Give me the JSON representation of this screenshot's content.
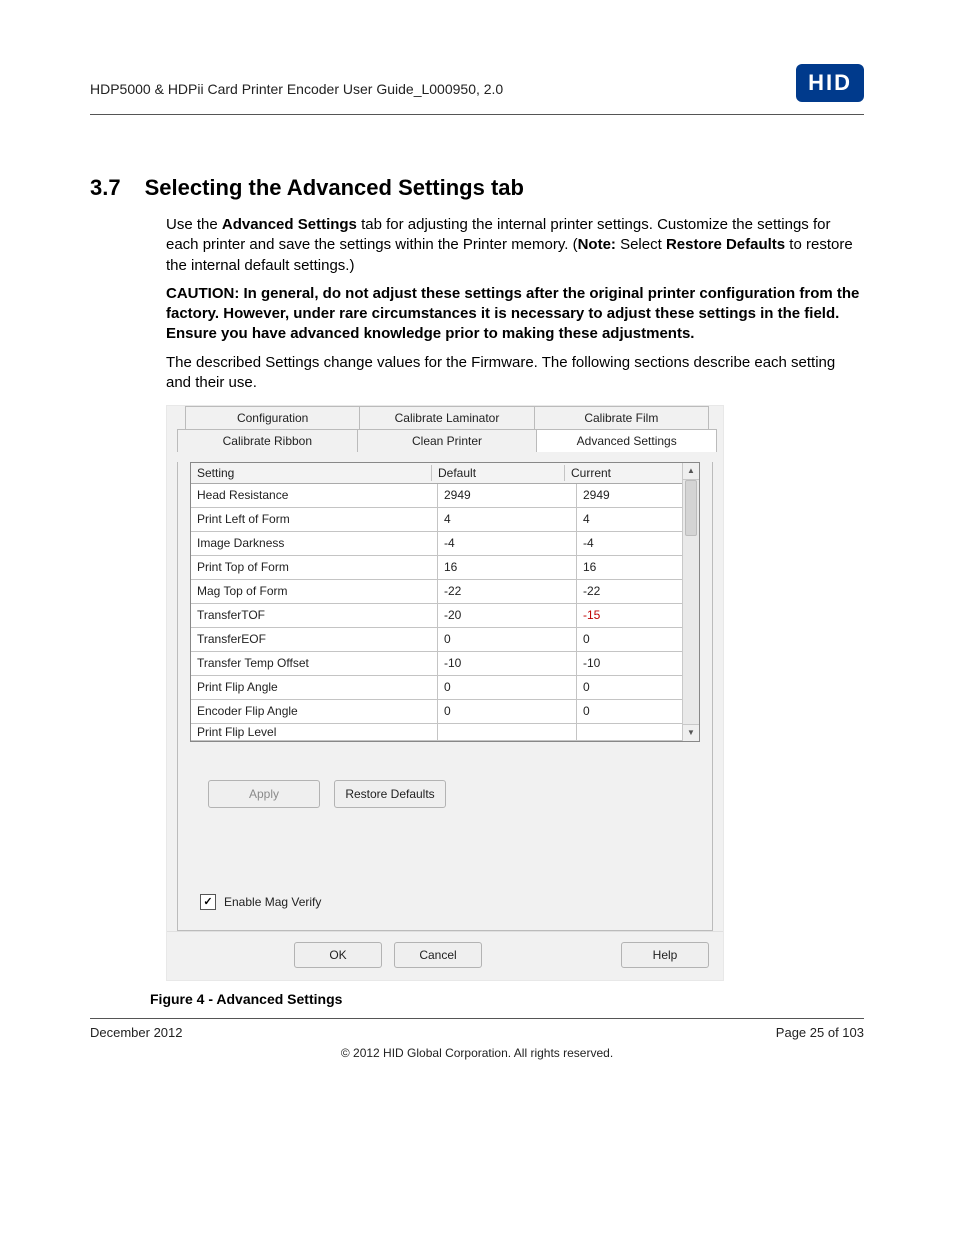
{
  "header": {
    "doc_title": "HDP5000 & HDPii Card Printer Encoder User Guide_L000950, 2.0",
    "logo_text": "HID"
  },
  "section": {
    "number": "3.7",
    "title": "Selecting the Advanced Settings tab",
    "p1a": "Use the ",
    "p1b": "Advanced Settings",
    "p1c": " tab for adjusting the internal printer settings. Customize the settings for each printer and save the settings within the Printer memory. (",
    "p1d": "Note:",
    "p1e": "  Select ",
    "p1f": "Restore Defaults",
    "p1g": " to restore the internal default settings.)",
    "caution": "CAUTION: In general, do not adjust these settings after the original printer configuration from the factory.  However, under rare circumstances it is necessary to adjust these settings in the field.  Ensure you have advanced knowledge prior to making these adjustments.",
    "p3": "The described Settings change values for the Firmware. The following sections describe each setting and their use."
  },
  "dialog": {
    "tabs_row1": [
      "Configuration",
      "Calibrate Laminator",
      "Calibrate Film"
    ],
    "tabs_row2": [
      "Calibrate Ribbon",
      "Clean Printer",
      "Advanced Settings"
    ],
    "headers": {
      "setting": "Setting",
      "default": "Default",
      "current": "Current"
    },
    "rows": [
      {
        "s": "Head Resistance",
        "d": "2949",
        "c": "2949",
        "diff": false
      },
      {
        "s": "Print Left of Form",
        "d": "4",
        "c": "4",
        "diff": false
      },
      {
        "s": "Image Darkness",
        "d": "-4",
        "c": "-4",
        "diff": false
      },
      {
        "s": "Print Top of Form",
        "d": "16",
        "c": "16",
        "diff": false
      },
      {
        "s": "Mag Top of Form",
        "d": "-22",
        "c": "-22",
        "diff": false
      },
      {
        "s": "TransferTOF",
        "d": "-20",
        "c": "-15",
        "diff": true
      },
      {
        "s": "TransferEOF",
        "d": "0",
        "c": "0",
        "diff": false
      },
      {
        "s": "Transfer Temp Offset",
        "d": "-10",
        "c": "-10",
        "diff": false
      },
      {
        "s": "Print Flip Angle",
        "d": "0",
        "c": "0",
        "diff": false
      },
      {
        "s": "Encoder Flip Angle",
        "d": "0",
        "c": "0",
        "diff": false
      }
    ],
    "partial_row_label": "Print Flip Level",
    "apply": "Apply",
    "restore": "Restore Defaults",
    "mag_label": "Enable Mag Verify",
    "ok": "OK",
    "cancel": "Cancel",
    "help": "Help"
  },
  "figure_caption": "Figure 4 - Advanced Settings",
  "footer": {
    "date": "December 2012",
    "page": "Page 25 of 103",
    "copyright": "© 2012 HID Global Corporation. All rights reserved."
  }
}
